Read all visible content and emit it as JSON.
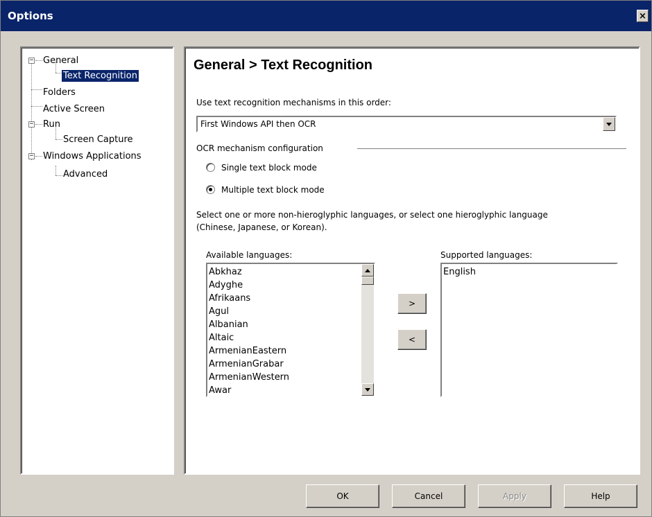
{
  "window": {
    "title": "Options",
    "close_label": "×"
  },
  "tree": {
    "expand_symbol": "−",
    "items": [
      {
        "label": "General"
      },
      {
        "label": "Text Recognition",
        "selected": true
      },
      {
        "label": "Folders"
      },
      {
        "label": "Active Screen"
      },
      {
        "label": "Run"
      },
      {
        "label": "Screen Capture"
      },
      {
        "label": "Windows Applications"
      },
      {
        "label": "Advanced"
      }
    ]
  },
  "content": {
    "heading": "General > Text Recognition",
    "order_label": "Use text recognition mechanisms in this order:",
    "order_value": "First Windows API then OCR",
    "ocr_group_label": "OCR mechanism configuration",
    "radio_single": {
      "label": "Single text block mode",
      "checked": false
    },
    "radio_multiple": {
      "label": "Multiple text block mode",
      "checked": true
    },
    "instructions_line1": "Select one or more non-hieroglyphic languages, or select one hieroglyphic language",
    "instructions_line2": "(Chinese, Japanese, or Korean).",
    "available_label": "Available languages:",
    "available_languages": [
      "Abkhaz",
      "Adyghe",
      "Afrikaans",
      "Agul",
      "Albanian",
      "Altaic",
      "ArmenianEastern",
      "ArmenianGrabar",
      "ArmenianWestern",
      "Awar"
    ],
    "supported_label": "Supported languages:",
    "supported_languages": [
      "English"
    ],
    "add_button": ">",
    "remove_button": "<"
  },
  "buttons": {
    "ok": "OK",
    "cancel": "Cancel",
    "apply": "Apply",
    "help": "Help"
  },
  "colors": {
    "title_bar": "#0a246a",
    "window_bg": "#d4d0c8",
    "selection": "#0a246a"
  }
}
